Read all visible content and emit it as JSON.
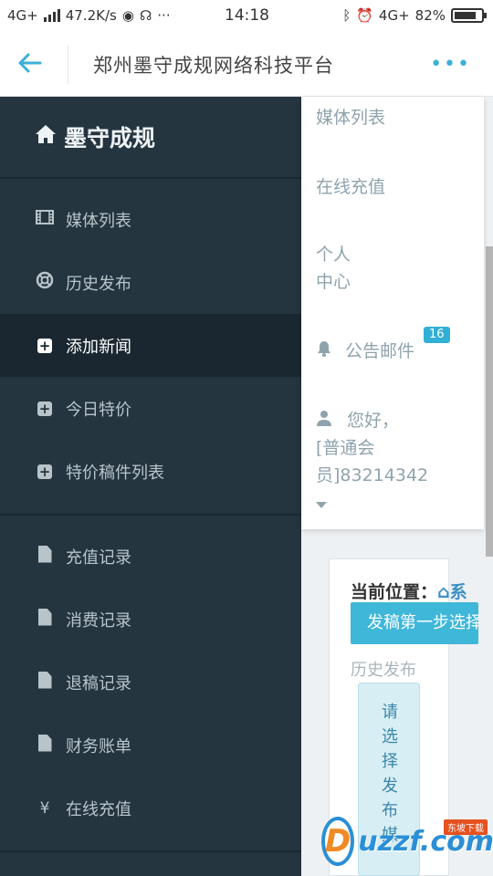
{
  "status_bar": {
    "network_left": "4G+",
    "speed": "47.2K/s",
    "time": "14:18",
    "network_right": "4G+",
    "battery": "82%",
    "battery_level": 0.82
  },
  "header": {
    "title": "郑州墨守成规网络科技平台",
    "back_icon": "arrow-left-icon",
    "more_icon": "ellipsis-icon",
    "accent_color": "#3bb0d9"
  },
  "sidebar": {
    "brand": "墨守成规",
    "brand_icon": "home-icon",
    "sections": [
      [
        {
          "label": "媒体列表",
          "icon": "film-icon"
        },
        {
          "label": "历史发布",
          "icon": "lifebuoy-icon"
        },
        {
          "label": "添加新闻",
          "icon": "plus-square-icon",
          "active": true
        },
        {
          "label": "今日特价",
          "icon": "plus-square-icon"
        },
        {
          "label": "特价稿件列表",
          "icon": "plus-square-icon"
        }
      ],
      [
        {
          "label": "充值记录",
          "icon": "file-icon"
        },
        {
          "label": "消费记录",
          "icon": "file-icon"
        },
        {
          "label": "退稿记录",
          "icon": "file-icon"
        },
        {
          "label": "财务账单",
          "icon": "file-icon"
        },
        {
          "label": "在线充值",
          "icon": "yen-icon",
          "glyph": "¥"
        }
      ]
    ]
  },
  "dropdown": {
    "media_list": "媒体列表",
    "recharge": "在线充值",
    "personal_1": "个人",
    "personal_2": "中心",
    "notice": "公告邮件",
    "notice_badge": "16",
    "greeting_1": "您好，",
    "greeting_2": "[普通会",
    "greeting_3": "员]83214342"
  },
  "content": {
    "location_label": "当前位置：",
    "location_rest": "系",
    "step_button": "发稿第一步选择",
    "history": "历史发布",
    "vertical_text": [
      "请",
      "选",
      "择",
      "发",
      "布",
      "媒"
    ]
  },
  "watermark": {
    "brand": "uzzf.com",
    "tag": "东坡下载"
  }
}
